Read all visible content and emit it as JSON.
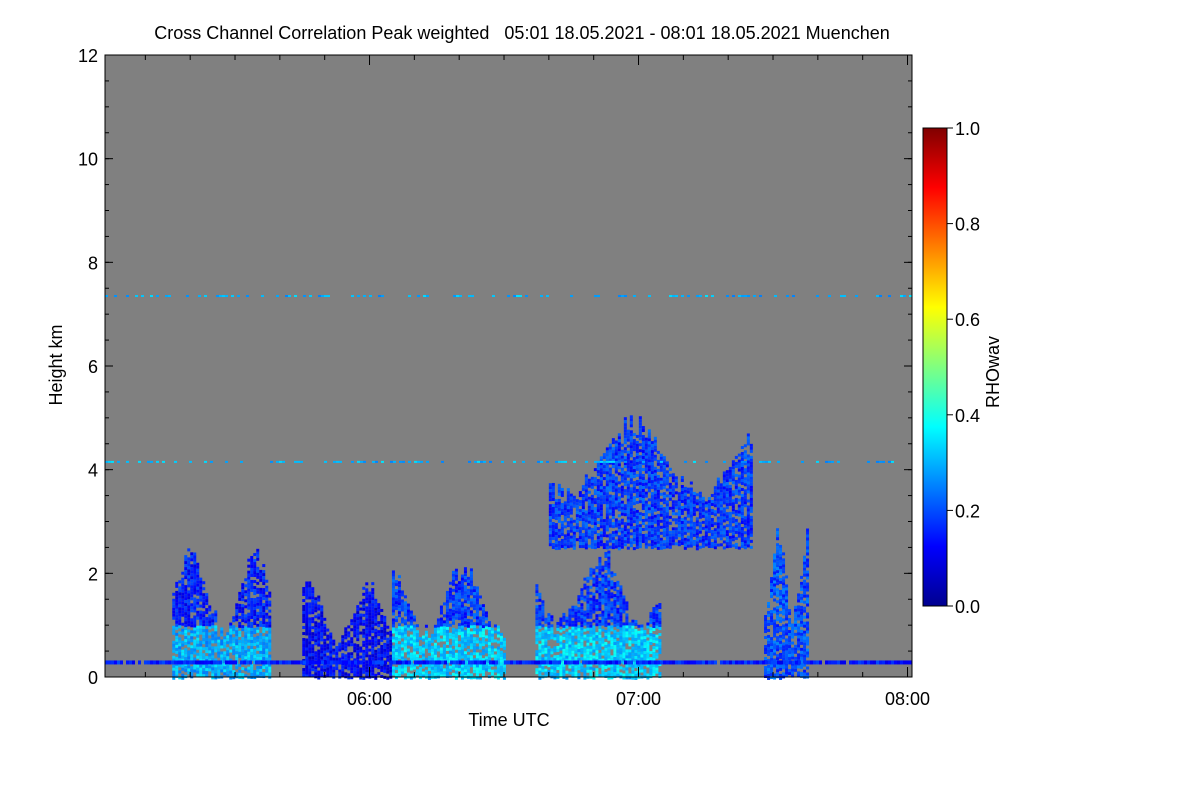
{
  "chart_data": {
    "type": "heatmap",
    "title": "Cross Channel Correlation Peak weighted   05:01 18.05.2021 - 08:01 18.05.2021 Muenchen",
    "xlabel": "Time UTC",
    "ylabel": "Height km",
    "xlim": [
      "05:01",
      "08:01"
    ],
    "ylim": [
      0,
      12
    ],
    "x_ticks": [
      "06:00",
      "07:00",
      "08:00"
    ],
    "y_ticks": [
      0,
      2,
      4,
      6,
      8,
      10,
      12
    ],
    "background_color": "#808080",
    "colorbar": {
      "label": "RHOwav",
      "range": [
        0.0,
        1.0
      ],
      "ticks": [
        "0.0",
        "0.2",
        "0.4",
        "0.6",
        "0.8",
        "1.0"
      ],
      "colors": [
        "#00008f",
        "#0000ff",
        "#0080ff",
        "#00ffff",
        "#80ff80",
        "#ffff00",
        "#ff8000",
        "#ff0000",
        "#800000"
      ]
    },
    "features": [
      {
        "kind": "aerosol-layer",
        "start": "05:16",
        "end": "05:38",
        "base_km": 0.0,
        "top_km": 2.5,
        "dense_below_km": 1.0,
        "rho_low": 0.3,
        "rho_high": 0.15
      },
      {
        "kind": "aerosol-layer",
        "start": "05:45",
        "end": "06:05",
        "base_km": 0.0,
        "top_km": 1.9,
        "rho_low": 0.15,
        "rho_high": 0.12
      },
      {
        "kind": "aerosol-layer",
        "start": "06:05",
        "end": "06:30",
        "base_km": 0.0,
        "top_km": 2.3,
        "dense_below_km": 1.0,
        "rho_low": 0.33,
        "rho_high": 0.18
      },
      {
        "kind": "aerosol-layer",
        "start": "06:37",
        "end": "07:05",
        "base_km": 0.0,
        "top_km": 2.6,
        "dense_below_km": 1.0,
        "rho_low": 0.33,
        "rho_high": 0.18
      },
      {
        "kind": "cloud",
        "start": "06:40",
        "end": "07:25",
        "base_km": 2.5,
        "top_km": 5.1,
        "rho": 0.18
      },
      {
        "kind": "plume",
        "start": "07:28",
        "end": "07:38",
        "base_km": 0.0,
        "top_km": 3.0,
        "rho": 0.2
      },
      {
        "kind": "faint-layer",
        "height_km": 7.35,
        "rho": 0.3
      },
      {
        "kind": "faint-layer",
        "height_km": 4.15,
        "rho": 0.3
      },
      {
        "kind": "surface-layer",
        "height_km": 0.3,
        "rho": 0.15
      }
    ]
  }
}
